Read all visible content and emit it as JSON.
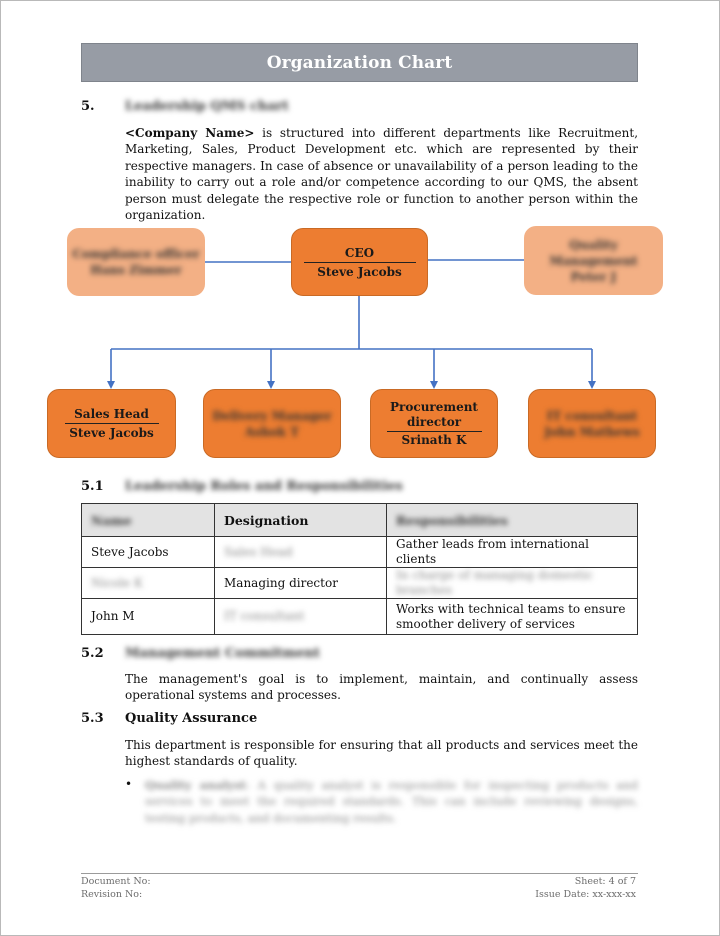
{
  "document": {
    "title": "Organization Chart",
    "section5": {
      "number": "5.",
      "title": "Leadership QMS chart",
      "intro_bold": "<Company Name>",
      "intro_rest": " is structured into different departments like Recruitment, Marketing, Sales, Product Development etc. which are represented by their respective managers. In case of absence or unavailability of a person leading to the inability to carry out a role and/or competence according to our QMS, the absent person must delegate the respective role or function to another person within the organization."
    },
    "org_chart": {
      "colors": {
        "primary_box": "#ed7d31",
        "faded_box": "#f3b085",
        "connector": "#4472c4"
      },
      "ceo": {
        "role": "CEO",
        "name": "Steve Jacobs"
      },
      "side_left": {
        "role": "Compliance officer",
        "name": "Hans Zimmer"
      },
      "side_right": {
        "role": "Quality Management",
        "name": "Peter J"
      },
      "reports": [
        {
          "role": "Sales Head",
          "name": "Steve Jacobs"
        },
        {
          "role": "Delivery Manager",
          "name": "Ashok T"
        },
        {
          "role": "Procurement director",
          "name": "Srinath K"
        },
        {
          "role": "IT consultant",
          "name": "John Mathews"
        }
      ]
    },
    "section5_1": {
      "number": "5.1",
      "title": "Leadership Roles and Responsibilities",
      "table": {
        "headers": [
          "Name",
          "Designation",
          "Responsibilities"
        ],
        "rows": [
          [
            "Steve Jacobs",
            "Sales Head",
            "Gather leads from international clients"
          ],
          [
            "Nicole K",
            "Managing director",
            "In charge of managing domestic branches"
          ],
          [
            "John M",
            "IT consultant",
            "Works with technical teams to ensure smoother delivery of services"
          ]
        ]
      }
    },
    "section5_2": {
      "number": "5.2",
      "title": "Management Commitment",
      "text": "The management's goal is to implement, maintain, and continually assess operational systems and processes."
    },
    "section5_3": {
      "number": "5.3",
      "title": "Quality Assurance",
      "text": "This department is responsible for ensuring that all products and services meet the highest standards of quality.",
      "bullets": [
        {
          "bold": "Quality analyst",
          "text": ": A quality analyst is responsible for inspecting products and services to meet the required standards. This can include reviewing designs, testing products, and documenting results."
        }
      ]
    },
    "footer": {
      "document_no": "Document No:",
      "revision_no": "Revision No:",
      "sheet": "Sheet: 4 of 7",
      "issue_date": "Issue Date: xx-xxx-xx"
    }
  }
}
